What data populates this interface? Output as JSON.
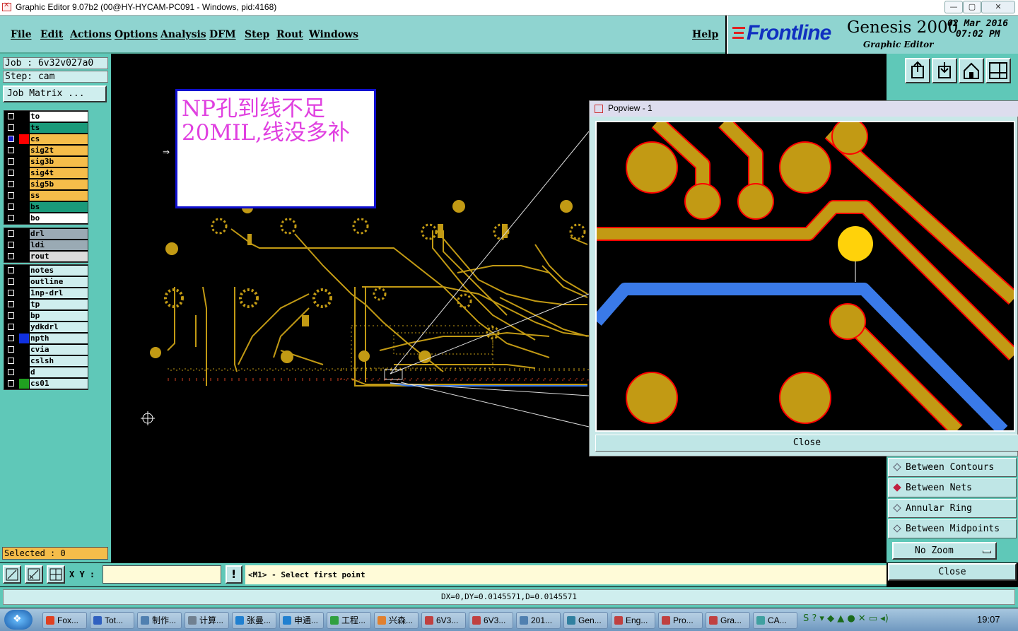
{
  "window": {
    "title": "Graphic Editor 9.07b2 (00@HY-HYCAM-PC091 - Windows, pid:4168)",
    "controls": [
      "—",
      "▢",
      "✕"
    ]
  },
  "menu": {
    "items": [
      "File",
      "Edit",
      "Actions",
      "Options",
      "Analysis",
      "DFM",
      "Step",
      "Rout",
      "Windows"
    ],
    "help": "Help"
  },
  "branding": {
    "logo": "Frontline",
    "product": "Genesis 2000",
    "subtitle": "Graphic Editor",
    "date": "02 Mar 2016",
    "time": "07:02 PM"
  },
  "job": {
    "job_line": "Job  : 6v32v027a0",
    "step_line": "Step: cam",
    "matrix_button": "Job Matrix ..."
  },
  "layers": {
    "group1": [
      {
        "name": "to",
        "bg": "#ffffff",
        "swatch": "#000000",
        "selected": false
      },
      {
        "name": "ts",
        "bg": "#1a9a7a",
        "swatch": "#000000",
        "selected": false
      },
      {
        "name": "cs",
        "bg": "#f5bd4a",
        "swatch": "#ff0000",
        "selected": true
      },
      {
        "name": "sig2t",
        "bg": "#f5bd4a",
        "swatch": "#000000",
        "selected": false
      },
      {
        "name": "sig3b",
        "bg": "#f5bd4a",
        "swatch": "#000000",
        "selected": false
      },
      {
        "name": "sig4t",
        "bg": "#f5bd4a",
        "swatch": "#000000",
        "selected": false
      },
      {
        "name": "sig5b",
        "bg": "#f5bd4a",
        "swatch": "#000000",
        "selected": false
      },
      {
        "name": "ss",
        "bg": "#f5bd4a",
        "swatch": "#000000",
        "selected": false
      },
      {
        "name": "bs",
        "bg": "#1a9a7a",
        "swatch": "#000000",
        "selected": false
      },
      {
        "name": "bo",
        "bg": "#ffffff",
        "swatch": "#000000",
        "selected": false
      }
    ],
    "group2": [
      {
        "name": "drl",
        "bg": "#9aaab4",
        "swatch": "#000000",
        "selected": false
      },
      {
        "name": "ldi",
        "bg": "#9aaab4",
        "swatch": "#000000",
        "selected": false
      },
      {
        "name": "rout",
        "bg": "#dcdcdc",
        "swatch": "#000000",
        "selected": false
      }
    ],
    "group3": [
      {
        "name": "notes",
        "bg": "#cfeeee",
        "swatch": "#000000",
        "selected": false
      },
      {
        "name": "outline",
        "bg": "#cfeeee",
        "swatch": "#000000",
        "selected": false
      },
      {
        "name": "1np-drl",
        "bg": "#cfeeee",
        "swatch": "#000000",
        "selected": false
      },
      {
        "name": "tp",
        "bg": "#cfeeee",
        "swatch": "#000000",
        "selected": false
      },
      {
        "name": "bp",
        "bg": "#cfeeee",
        "swatch": "#000000",
        "selected": false
      },
      {
        "name": "ydkdrl",
        "bg": "#cfeeee",
        "swatch": "#000000",
        "selected": false
      },
      {
        "name": "npth",
        "bg": "#cfeeee",
        "swatch": "#1030e0",
        "selected": false
      },
      {
        "name": "cvia",
        "bg": "#cfeeee",
        "swatch": "#000000",
        "selected": false
      },
      {
        "name": "cslsh",
        "bg": "#cfeeee",
        "swatch": "#000000",
        "selected": false
      },
      {
        "name": "d",
        "bg": "#cfeeee",
        "swatch": "#000000",
        "selected": false
      },
      {
        "name": "cs01",
        "bg": "#cfeeee",
        "swatch": "#20a020",
        "selected": false
      }
    ]
  },
  "selected_count": "Selected : 0",
  "note": {
    "text": "NP孔到线不足20MIL,线没多补"
  },
  "popview": {
    "title": "Popview - 1",
    "close_label": "Close"
  },
  "right_panel": {
    "options": [
      {
        "label": "Between Contours",
        "active": false
      },
      {
        "label": "Between Nets",
        "active": true
      },
      {
        "label": "Annular Ring",
        "active": false
      },
      {
        "label": "Between Midpoints",
        "active": false
      }
    ],
    "zoom_select": "No Zoom",
    "close_label": "Close"
  },
  "command": {
    "xy_label": "X Y :",
    "xy_value": "",
    "prompt": "<M1> - Select first point"
  },
  "measurement": "DX=0,DY=0.0145571,D=0.0145571",
  "taskbar": {
    "items": [
      "Fox...",
      "Tot...",
      "制作...",
      "计算...",
      "张曼...",
      "申通...",
      "工程...",
      "兴森...",
      "6V3...",
      "6V3...",
      "201...",
      "Gen...",
      "Eng...",
      "Pro...",
      "Gra...",
      "CA..."
    ],
    "clock": "19:07"
  },
  "colors": {
    "panel": "#5fc8b8",
    "menubar": "#8fd4d0",
    "copper": "#c29a14",
    "selected_trace": "#3a7ae8",
    "note_text": "#e040e0"
  }
}
